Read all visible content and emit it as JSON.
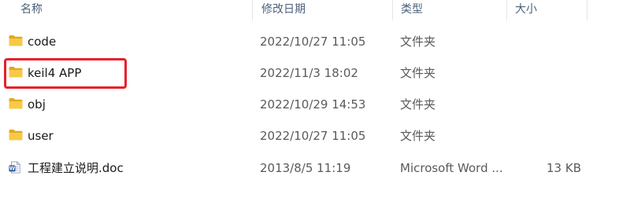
{
  "header": {
    "name": "名称",
    "date_modified": "修改日期",
    "type": "类型",
    "size": "大小"
  },
  "files": [
    {
      "icon": "folder-icon",
      "name": "code",
      "date": "2022/10/27 11:05",
      "type": "文件夹",
      "size": ""
    },
    {
      "icon": "folder-icon",
      "name": "keil4 APP",
      "date": "2022/11/3 18:02",
      "type": "文件夹",
      "size": ""
    },
    {
      "icon": "folder-icon",
      "name": "obj",
      "date": "2022/10/29 14:53",
      "type": "文件夹",
      "size": ""
    },
    {
      "icon": "folder-icon",
      "name": "user",
      "date": "2022/10/27 11:05",
      "type": "文件夹",
      "size": ""
    },
    {
      "icon": "word-doc-icon",
      "name": "工程建立说明.doc",
      "date": "2013/8/5 11:19",
      "type": "Microsoft Word ...",
      "size": "13 KB"
    }
  ],
  "colors": {
    "folder": "#f7c948",
    "folder_dark": "#e3a81c",
    "word_blue": "#2b5797",
    "annotation_red": "#e8202a",
    "header_text": "#4c607a"
  }
}
